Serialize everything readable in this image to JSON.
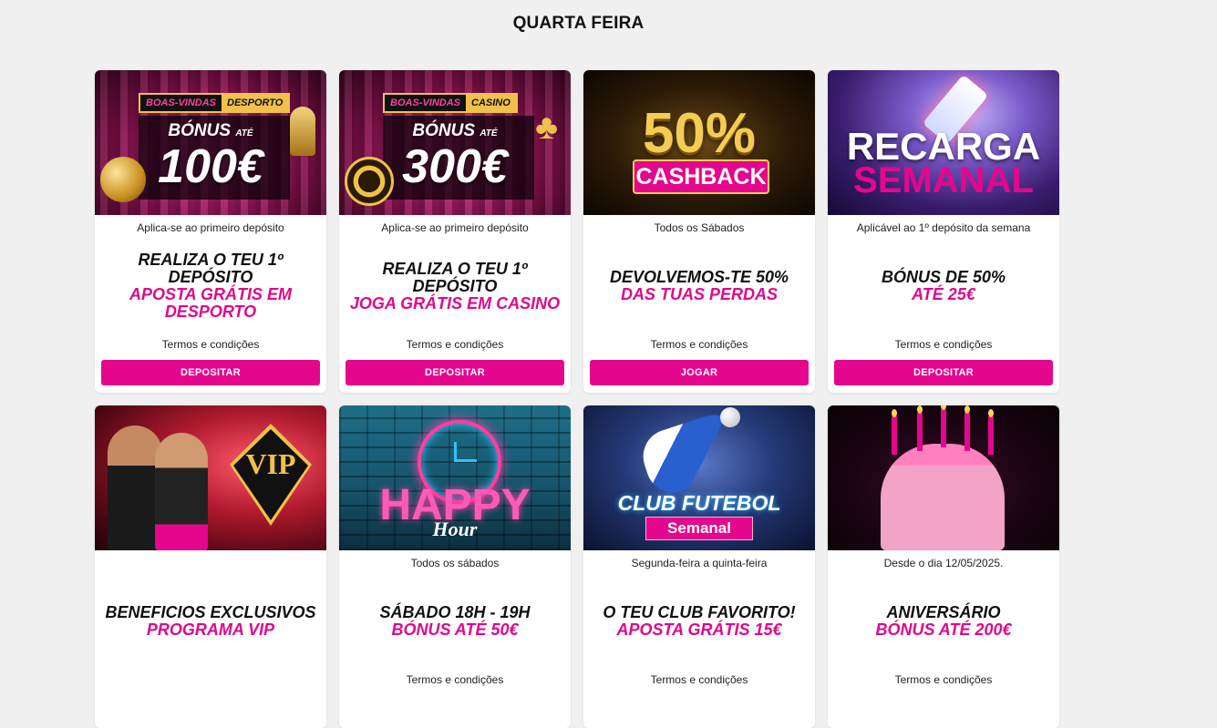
{
  "page": {
    "title": "QUARTA FEIRA"
  },
  "cards": [
    {
      "banner": {
        "badge_left": "BOAS-VINDAS",
        "badge_right": "DESPORTO",
        "bonus_label": "BÓNUS",
        "bonus_ate": "ATÉ",
        "amount": "100€"
      },
      "availability": "Aplica-se ao primeiro depósito",
      "line1": "REALIZA O TEU 1º DEPÓSITO",
      "line2": "APOSTA GRÁTIS EM DESPORTO",
      "terms": "Termos e condições",
      "cta": "DEPOSITAR"
    },
    {
      "banner": {
        "badge_left": "BOAS-VINDAS",
        "badge_right": "CASINO",
        "bonus_label": "BÓNUS",
        "bonus_ate": "ATÉ",
        "amount": "300€"
      },
      "availability": "Aplica-se ao primeiro depósito",
      "line1": "REALIZA O TEU 1º DEPÓSITO",
      "line2": "JOGA GRÁTIS EM CASINO",
      "terms": "Termos e condições",
      "cta": "DEPOSITAR"
    },
    {
      "banner": {
        "big": "50%",
        "ribbon": "CASHBACK"
      },
      "availability": "Todos os Sábados",
      "line1": "DEVOLVEMOS-TE 50%",
      "line2": "DAS TUAS PERDAS",
      "terms": "Termos e condições",
      "cta": "JOGAR"
    },
    {
      "banner": {
        "top": "RECARGA",
        "bottom": "SEMANAL"
      },
      "availability": "Aplicável ao 1º depósito da semana",
      "line1": "BÓNUS DE 50%",
      "line2": "ATÉ 25€",
      "terms": "Termos e condições",
      "cta": "DEPOSITAR"
    },
    {
      "banner": {
        "emblem": "VIP"
      },
      "availability": "",
      "line1": "BENEFICIOS EXCLUSIVOS",
      "line2": "PROGRAMA VIP",
      "terms": "",
      "cta": ""
    },
    {
      "banner": {
        "top": "HAPPY",
        "bottom": "Hour"
      },
      "availability": "Todos os sábados",
      "line1": "SÁBADO 18H - 19H",
      "line2": "BÓNUS ATÉ 50€",
      "terms": "Termos e condições",
      "cta": ""
    },
    {
      "banner": {
        "top": "CLUB FUTEBOL",
        "bottom": "Semanal"
      },
      "availability": "Segunda-feira a quinta-feira",
      "line1": "O TEU CLUB FAVORITO!",
      "line2": "APOSTA GRÁTIS 15€",
      "terms": "Termos e condições",
      "cta": ""
    },
    {
      "banner": {},
      "availability": "Desde o dia 12/05/2025.",
      "line1": "ANIVERSÁRIO",
      "line2": "BÓNUS ATÉ 200€",
      "terms": "Termos e condições",
      "cta": ""
    }
  ]
}
